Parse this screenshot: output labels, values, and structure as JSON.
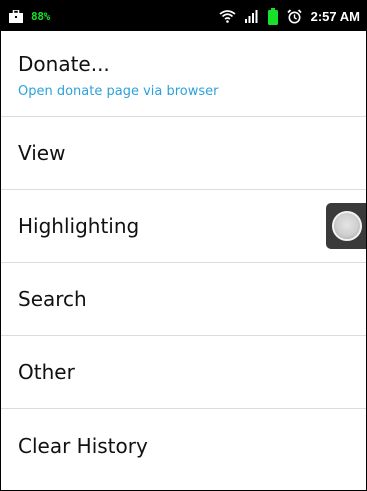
{
  "status_bar": {
    "left_icon": "briefcase-icon",
    "battery_text": "88%",
    "icons": [
      "wifi-icon",
      "signal-icon",
      "battery-icon",
      "alarm-icon"
    ],
    "time": "2:57 AM"
  },
  "items": [
    {
      "title": "Donate...",
      "summary": "Open donate page via browser"
    },
    {
      "title": "View"
    },
    {
      "title": "Highlighting"
    },
    {
      "title": "Search"
    },
    {
      "title": "Other"
    },
    {
      "title": "Clear History"
    }
  ],
  "colors": {
    "status_bar_bg": "#000000",
    "accent_summary": "#2ea1da",
    "green_indicator": "#19e02a",
    "divider": "#dcdcdc"
  }
}
